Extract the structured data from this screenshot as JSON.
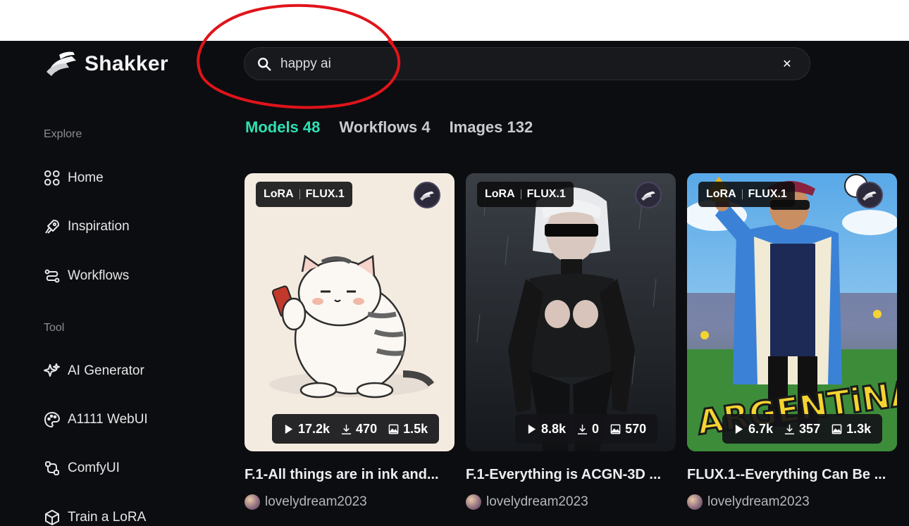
{
  "brand": {
    "name": "Shakker"
  },
  "search": {
    "value": "happy ai",
    "clear_icon": "close-icon"
  },
  "sidebar": {
    "explore_heading": "Explore",
    "explore_items": [
      {
        "label": "Home",
        "icon": "grid-icon"
      },
      {
        "label": "Inspiration",
        "icon": "rocket-icon"
      },
      {
        "label": "Workflows",
        "icon": "workflow-icon"
      }
    ],
    "tool_heading": "Tool",
    "tool_items": [
      {
        "label": "AI Generator",
        "icon": "sparkle-icon"
      },
      {
        "label": "A1111 WebUI",
        "icon": "palette-icon"
      },
      {
        "label": "ComfyUI",
        "icon": "nodes-icon"
      },
      {
        "label": "Train a LoRA",
        "icon": "cube-icon"
      }
    ]
  },
  "tabs": [
    {
      "label": "Models 48",
      "active": true
    },
    {
      "label": "Workflows 4",
      "active": false
    },
    {
      "label": "Images 132",
      "active": false
    }
  ],
  "cards": [
    {
      "tag_type": "LoRA",
      "tag_base": "FLUX.1",
      "runs": "17.2k",
      "downloads": "470",
      "images": "1.5k",
      "title": "F.1-All things are in ink and...",
      "author": "lovelydream2023"
    },
    {
      "tag_type": "LoRA",
      "tag_base": "FLUX.1",
      "runs": "8.8k",
      "downloads": "0",
      "images": "570",
      "title": "F.1-Everything is ACGN-3D ...",
      "author": "lovelydream2023"
    },
    {
      "tag_type": "LoRA",
      "tag_base": "FLUX.1",
      "runs": "6.7k",
      "downloads": "357",
      "images": "1.3k",
      "title": "FLUX.1--Everything Can Be ...",
      "author": "lovelydream2023"
    }
  ],
  "colors": {
    "accent": "#2fe0b3",
    "background": "#0c0d10",
    "annotation": "#e0141a"
  }
}
